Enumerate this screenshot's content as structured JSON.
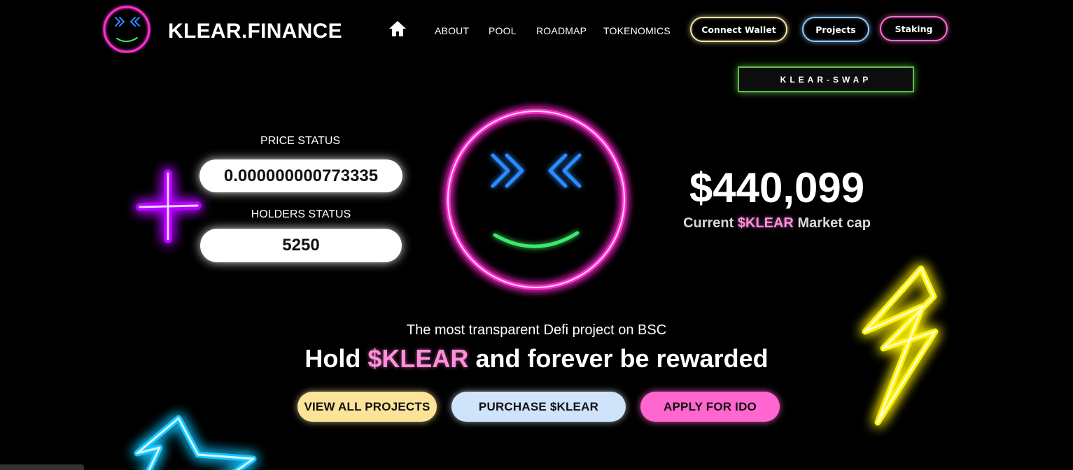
{
  "header": {
    "brand": "KLEAR.FINANCE",
    "logo_icon": "smiley-face-icon",
    "home_icon": "home-icon",
    "nav": [
      "ABOUT",
      "POOL",
      "ROADMAP",
      "TOKENOMICS"
    ],
    "buttons": {
      "connect_wallet": "Connect Wallet",
      "projects": "Projects",
      "staking": "Staking",
      "swap": "KLEAR-SWAP"
    }
  },
  "stats": {
    "price_label": "PRICE STATUS",
    "price_value": "0.000000000773335",
    "holders_label": "HOLDERS STATUS",
    "holders_value": "5250"
  },
  "market_cap": {
    "value": "$440,099",
    "label_prefix": "Current",
    "token": "$KLEAR",
    "label_suffix": "Market cap"
  },
  "hero": {
    "tagline": "The most transparent Defi project on BSC",
    "headline_prefix": "Hold",
    "headline_token": "$KLEAR",
    "headline_suffix": "and forever be rewarded"
  },
  "cta": {
    "view_projects": "VIEW ALL PROJECTS",
    "purchase": "PURCHASE $KLEAR",
    "apply": "APPLY FOR IDO"
  },
  "colors": {
    "background": "#000000",
    "neon_pink": "#ff3ad1",
    "neon_blue": "#2b8cff",
    "neon_green": "#3ee86a",
    "neon_yellow": "#fff200",
    "neon_purple": "#b400ff",
    "neon_cyan": "#18c6ff"
  }
}
